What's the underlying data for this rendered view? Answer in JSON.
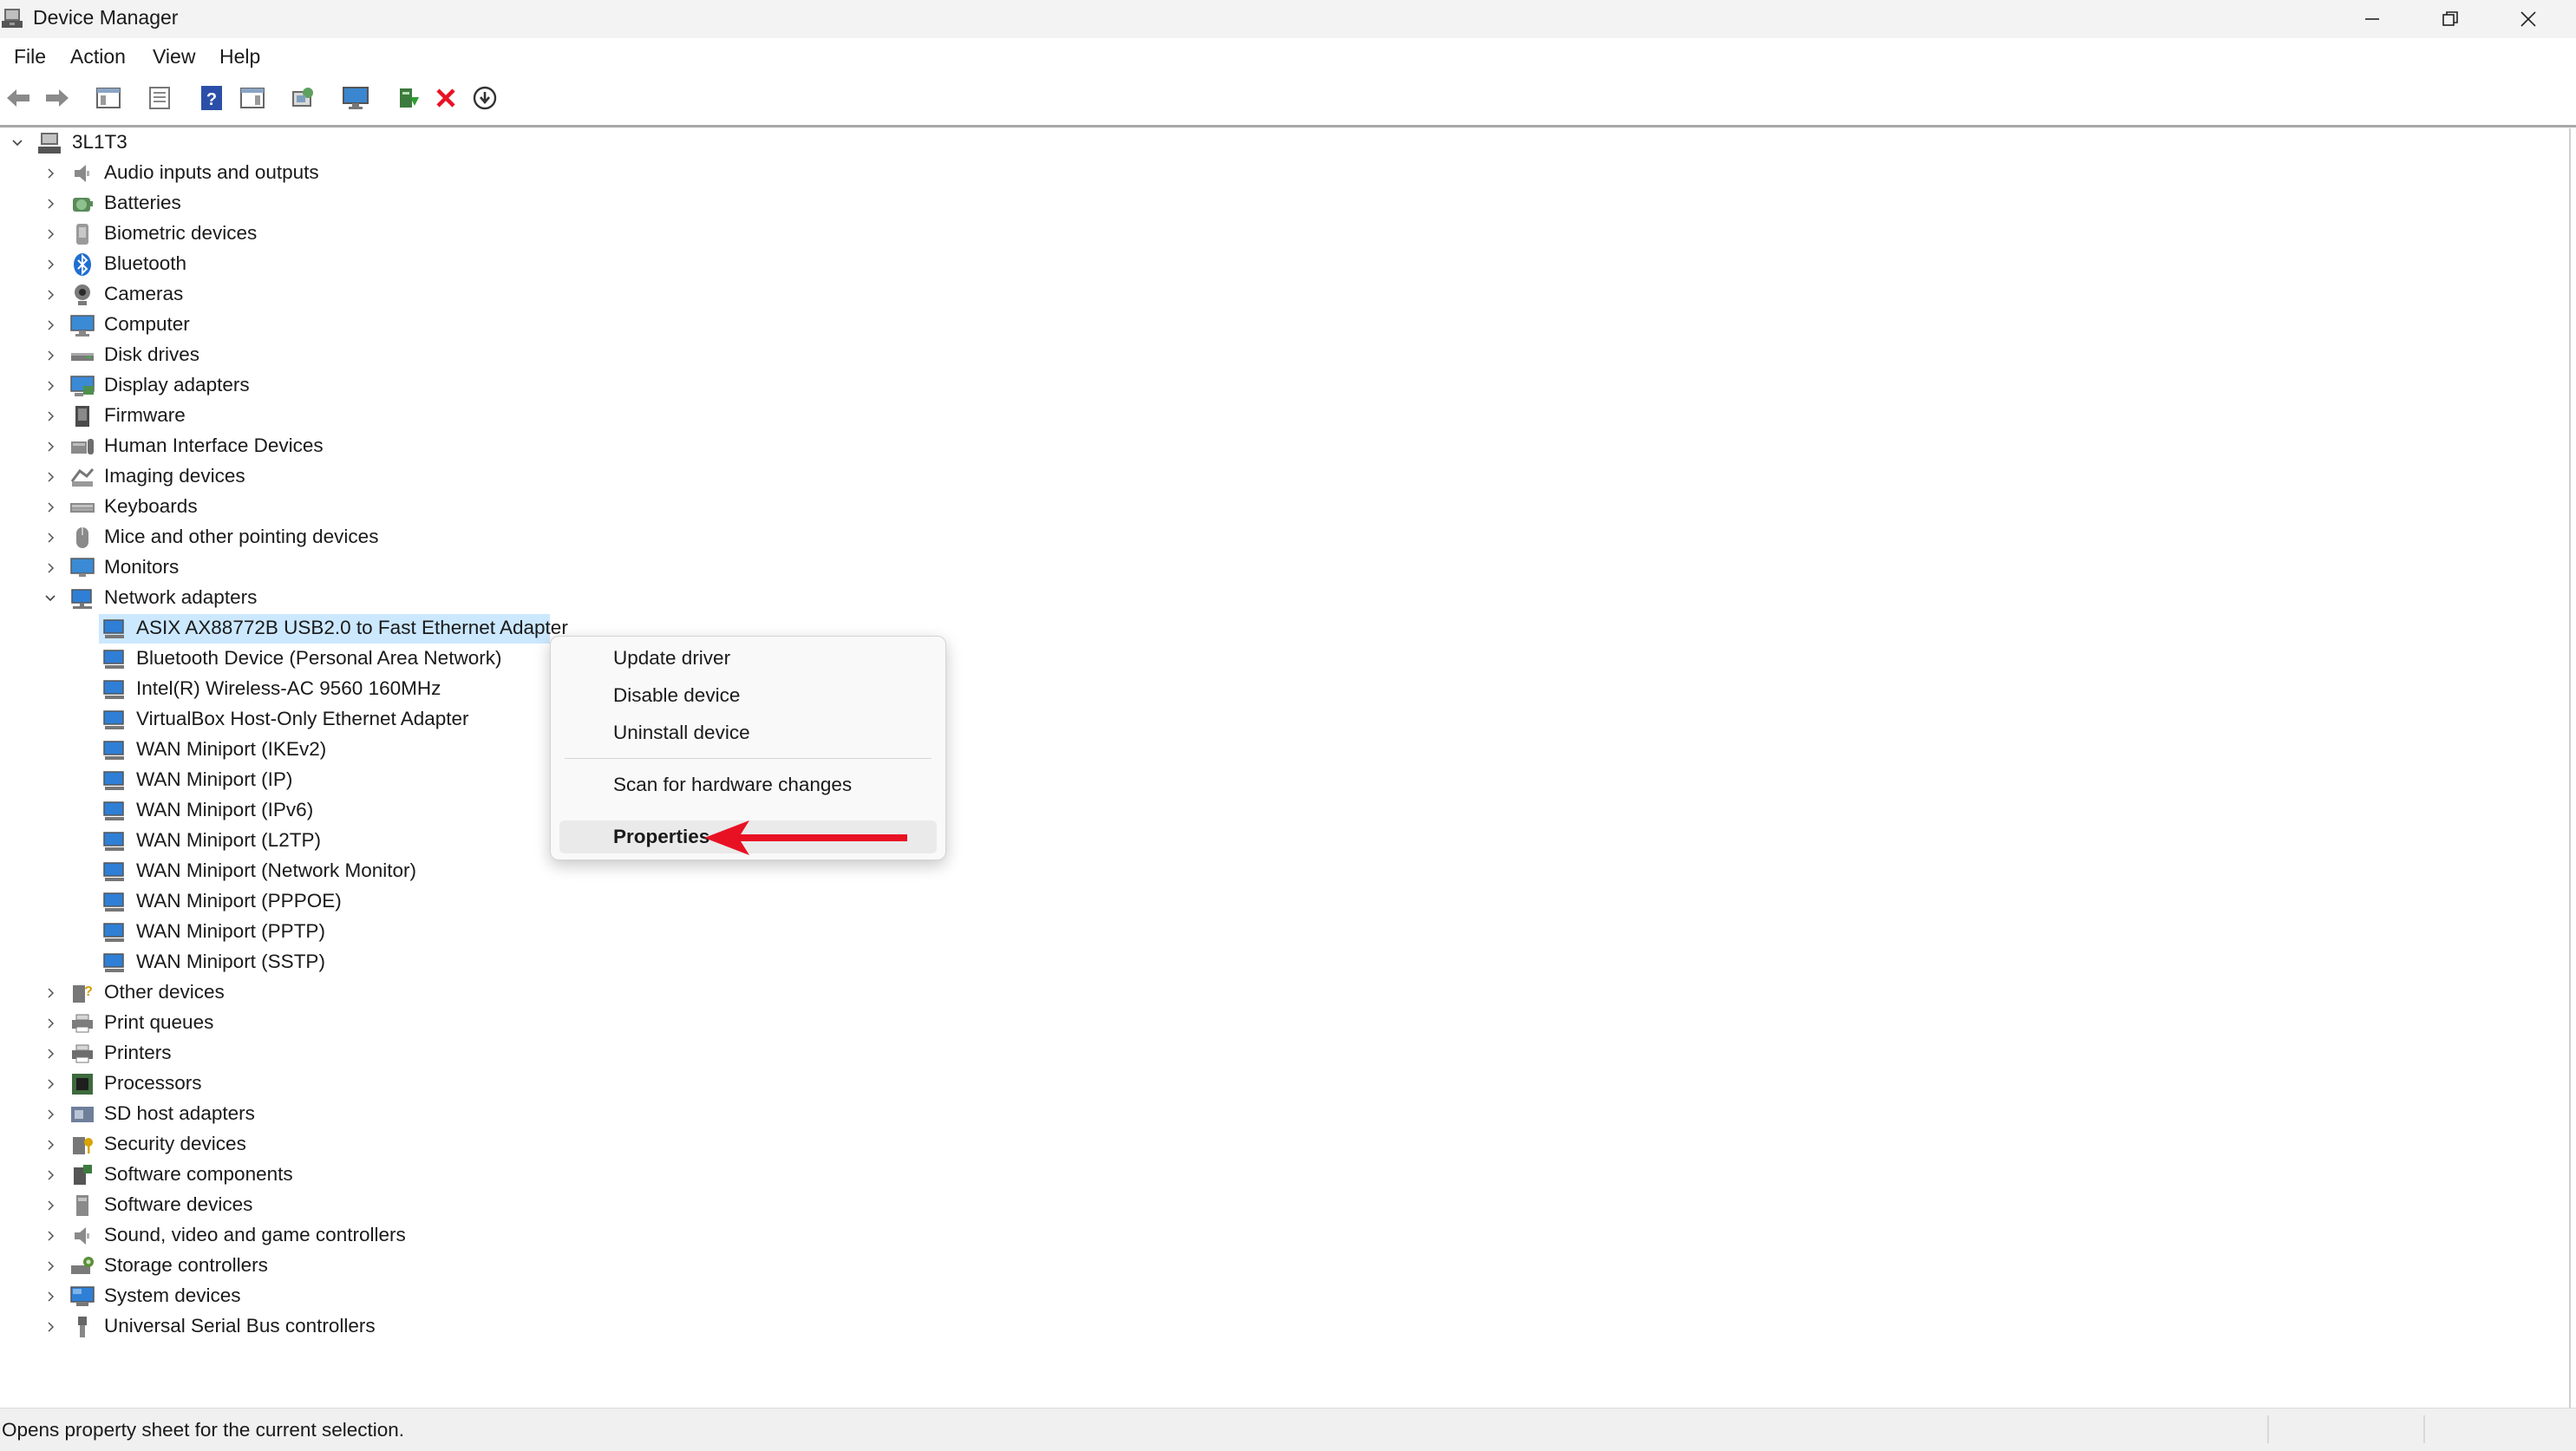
{
  "window": {
    "title": "Device Manager",
    "icon": "device-manager-icon"
  },
  "window_controls": {
    "minimize_icon": "minimize-icon",
    "restore_icon": "restore-icon",
    "close_icon": "close-icon"
  },
  "menu": [
    "File",
    "Action",
    "View",
    "Help"
  ],
  "toolbar": [
    "back-arrow-icon",
    "forward-arrow-icon",
    "show-hide-console-tree-icon",
    "properties-sheet-icon",
    "help-icon",
    "action-pane-icon",
    "scan-hardware-icon",
    "monitor-icon",
    "update-driver-icon",
    "uninstall-x-icon",
    "download-icon"
  ],
  "tree": {
    "root": "3L1T3",
    "categories": [
      {
        "label": "Audio inputs and outputs",
        "icon": "speaker-icon"
      },
      {
        "label": "Batteries",
        "icon": "battery-icon"
      },
      {
        "label": "Biometric devices",
        "icon": "biometric-icon"
      },
      {
        "label": "Bluetooth",
        "icon": "bluetooth-icon"
      },
      {
        "label": "Cameras",
        "icon": "camera-icon"
      },
      {
        "label": "Computer",
        "icon": "computer-icon"
      },
      {
        "label": "Disk drives",
        "icon": "disk-drive-icon"
      },
      {
        "label": "Display adapters",
        "icon": "display-adapter-icon"
      },
      {
        "label": "Firmware",
        "icon": "firmware-icon"
      },
      {
        "label": "Human Interface Devices",
        "icon": "hid-icon"
      },
      {
        "label": "Imaging devices",
        "icon": "imaging-icon"
      },
      {
        "label": "Keyboards",
        "icon": "keyboard-icon"
      },
      {
        "label": "Mice and other pointing devices",
        "icon": "mouse-icon"
      },
      {
        "label": "Monitors",
        "icon": "monitor-icon"
      },
      {
        "label": "Network adapters",
        "icon": "network-adapter-icon",
        "expanded": true
      }
    ],
    "network_children": [
      "ASIX AX88772B USB2.0 to Fast Ethernet Adapter",
      "Bluetooth Device (Personal Area Network)",
      "Intel(R) Wireless-AC 9560 160MHz",
      "VirtualBox Host-Only Ethernet Adapter",
      "WAN Miniport (IKEv2)",
      "WAN Miniport (IP)",
      "WAN Miniport (IPv6)",
      "WAN Miniport (L2TP)",
      "WAN Miniport (Network Monitor)",
      "WAN Miniport (PPPOE)",
      "WAN Miniport (PPTP)",
      "WAN Miniport (SSTP)"
    ],
    "categories_after": [
      {
        "label": "Other devices",
        "icon": "other-devices-icon"
      },
      {
        "label": "Print queues",
        "icon": "print-queue-icon"
      },
      {
        "label": "Printers",
        "icon": "printer-icon"
      },
      {
        "label": "Processors",
        "icon": "processor-icon"
      },
      {
        "label": "SD host adapters",
        "icon": "sd-host-icon"
      },
      {
        "label": "Security devices",
        "icon": "security-device-icon"
      },
      {
        "label": "Software components",
        "icon": "software-component-icon"
      },
      {
        "label": "Software devices",
        "icon": "software-device-icon"
      },
      {
        "label": "Sound, video and game controllers",
        "icon": "speaker-icon"
      },
      {
        "label": "Storage controllers",
        "icon": "storage-controller-icon"
      },
      {
        "label": "System devices",
        "icon": "system-device-icon"
      },
      {
        "label": "Universal Serial Bus controllers",
        "icon": "usb-icon"
      }
    ]
  },
  "context_menu": {
    "items": [
      "Update driver",
      "Disable device",
      "Uninstall device",
      "Scan for hardware changes",
      "Properties"
    ],
    "highlighted": "Properties",
    "annotation_icon": "red-arrow-icon"
  },
  "status_bar": {
    "text": "Opens property sheet for the current selection."
  },
  "colors": {
    "selection": "#cce8ff",
    "accent_red": "#e81123",
    "network_icon": "#2f7fd6"
  }
}
